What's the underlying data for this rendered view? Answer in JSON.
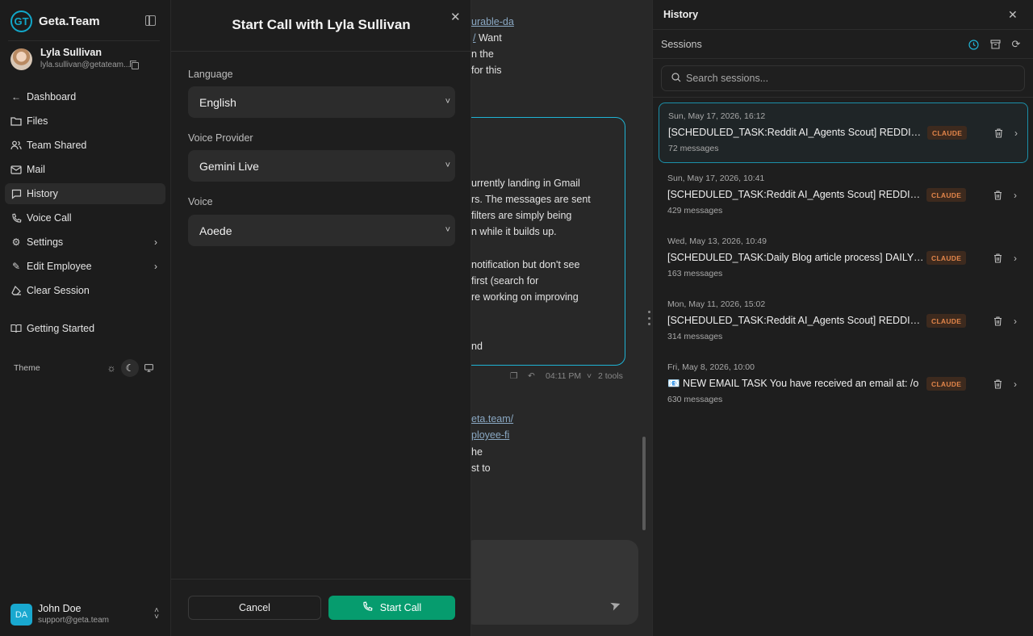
{
  "app": {
    "brand_logo": "GT",
    "brand_name": "Geta.Team"
  },
  "profile": {
    "name": "Lyla Sullivan",
    "email": "lyla.sullivan@getateam..."
  },
  "sidebar": {
    "items": [
      {
        "label": "Dashboard",
        "icon": "arrow-left-icon"
      },
      {
        "label": "Files",
        "icon": "folder-icon"
      },
      {
        "label": "Team Shared",
        "icon": "users-icon"
      },
      {
        "label": "Mail",
        "icon": "mail-icon"
      },
      {
        "label": "History",
        "icon": "chat-icon"
      },
      {
        "label": "Voice Call",
        "icon": "phone-icon"
      },
      {
        "label": "Settings",
        "icon": "gear-icon"
      },
      {
        "label": "Edit Employee",
        "icon": "pencil-icon"
      },
      {
        "label": "Clear Session",
        "icon": "eraser-icon"
      },
      {
        "label": "Getting Started",
        "icon": "book-icon"
      }
    ],
    "theme_label": "Theme",
    "theme_selected": "dark"
  },
  "user": {
    "initials": "DA",
    "name": "John Doe",
    "email": "support@geta.team"
  },
  "chat": {
    "lines": [
      "urable-da",
      "/ Want",
      "n the",
      "for this"
    ],
    "bubble_lines": [
      "urrently landing in Gmail",
      "rs. The messages are sent",
      " filters are simply being",
      "n while it builds up.",
      "notification but don't see",
      " first (search for",
      "re working on improving",
      "nd"
    ],
    "time": "04:11 PM",
    "tools": "2 tools",
    "lines_after": [
      "eta.team/",
      "ployee-fi",
      "he",
      "st to"
    ]
  },
  "call": {
    "title": "Start Call with Lyla Sullivan",
    "language_label": "Language",
    "language_value": "English",
    "provider_label": "Voice Provider",
    "provider_value": "Gemini Live",
    "voice_label": "Voice",
    "voice_value": "Aoede",
    "cancel_label": "Cancel",
    "start_label": "Start Call"
  },
  "history": {
    "title": "History",
    "sessions_label": "Sessions",
    "search_placeholder": "Search sessions...",
    "sessions": [
      {
        "date": "Sun, May 17, 2026, 16:12",
        "title": "[SCHEDULED_TASK:Reddit AI_Agents Scout] REDDIT SCOUT TASK",
        "badge": "CLAUDE",
        "count": "72 messages"
      },
      {
        "date": "Sun, May 17, 2026, 10:41",
        "title": "[SCHEDULED_TASK:Reddit AI_Agents Scout] REDDIT SCOUT TASK",
        "badge": "CLAUDE",
        "count": "429 messages"
      },
      {
        "date": "Wed, May 13, 2026, 10:49",
        "title": "[SCHEDULED_TASK:Daily Blog article process] DAILY BLOG ARTICLE",
        "badge": "CLAUDE",
        "count": "163 messages"
      },
      {
        "date": "Mon, May 11, 2026, 15:02",
        "title": "[SCHEDULED_TASK:Reddit AI_Agents Scout] REDDIT SCOUT TASK",
        "badge": "CLAUDE",
        "count": "314 messages"
      },
      {
        "date": "Fri, May 8, 2026, 10:00",
        "title": "📧 NEW EMAIL TASK You have received an email at: /o",
        "badge": "CLAUDE",
        "count": "630 messages"
      }
    ]
  },
  "colors": {
    "accent": "#1fb3d4",
    "primary_button": "#069c6e",
    "badge_text": "#e2854a",
    "badge_bg": "#3d2a1e"
  }
}
